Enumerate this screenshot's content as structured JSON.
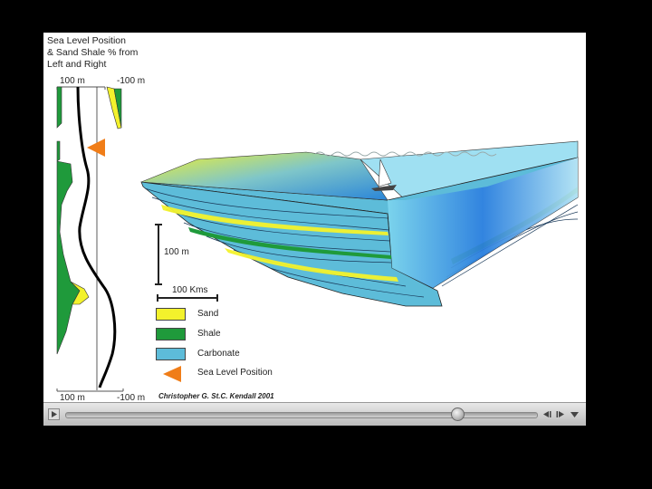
{
  "figure": {
    "title_lines": [
      "Sea Level Position",
      "& Sand Shale % from",
      "Left and Right"
    ],
    "top_scale": {
      "left": "100 m",
      "right": "-100 m"
    },
    "bottom_scale": {
      "left": "100 m",
      "right": "-100 m"
    },
    "vertical_scale": "100 m",
    "horizontal_scale": "100 Kms",
    "credit": "Christopher G. St.C. Kendall 2001"
  },
  "legend": [
    {
      "label": "Sand",
      "color": "#f3f22c"
    },
    {
      "label": "Shale",
      "color": "#1f9a3b"
    },
    {
      "label": "Carbonate",
      "color": "#5dbcd9"
    },
    {
      "label": "Sea Level Position",
      "color": "#f07d18",
      "icon": "triangle-marker-icon"
    }
  ],
  "player": {
    "play_icon": "play-icon",
    "progress_fraction": 0.83,
    "step_back_icon": "step-back-icon",
    "step_forward_icon": "step-forward-icon",
    "menu_icon": "dropdown-menu-icon"
  },
  "colors": {
    "sea_level_marker": "#f07d18",
    "sand": "#f3f22c",
    "shale": "#1f9a3b",
    "carbonate": "#5dbcd9"
  }
}
